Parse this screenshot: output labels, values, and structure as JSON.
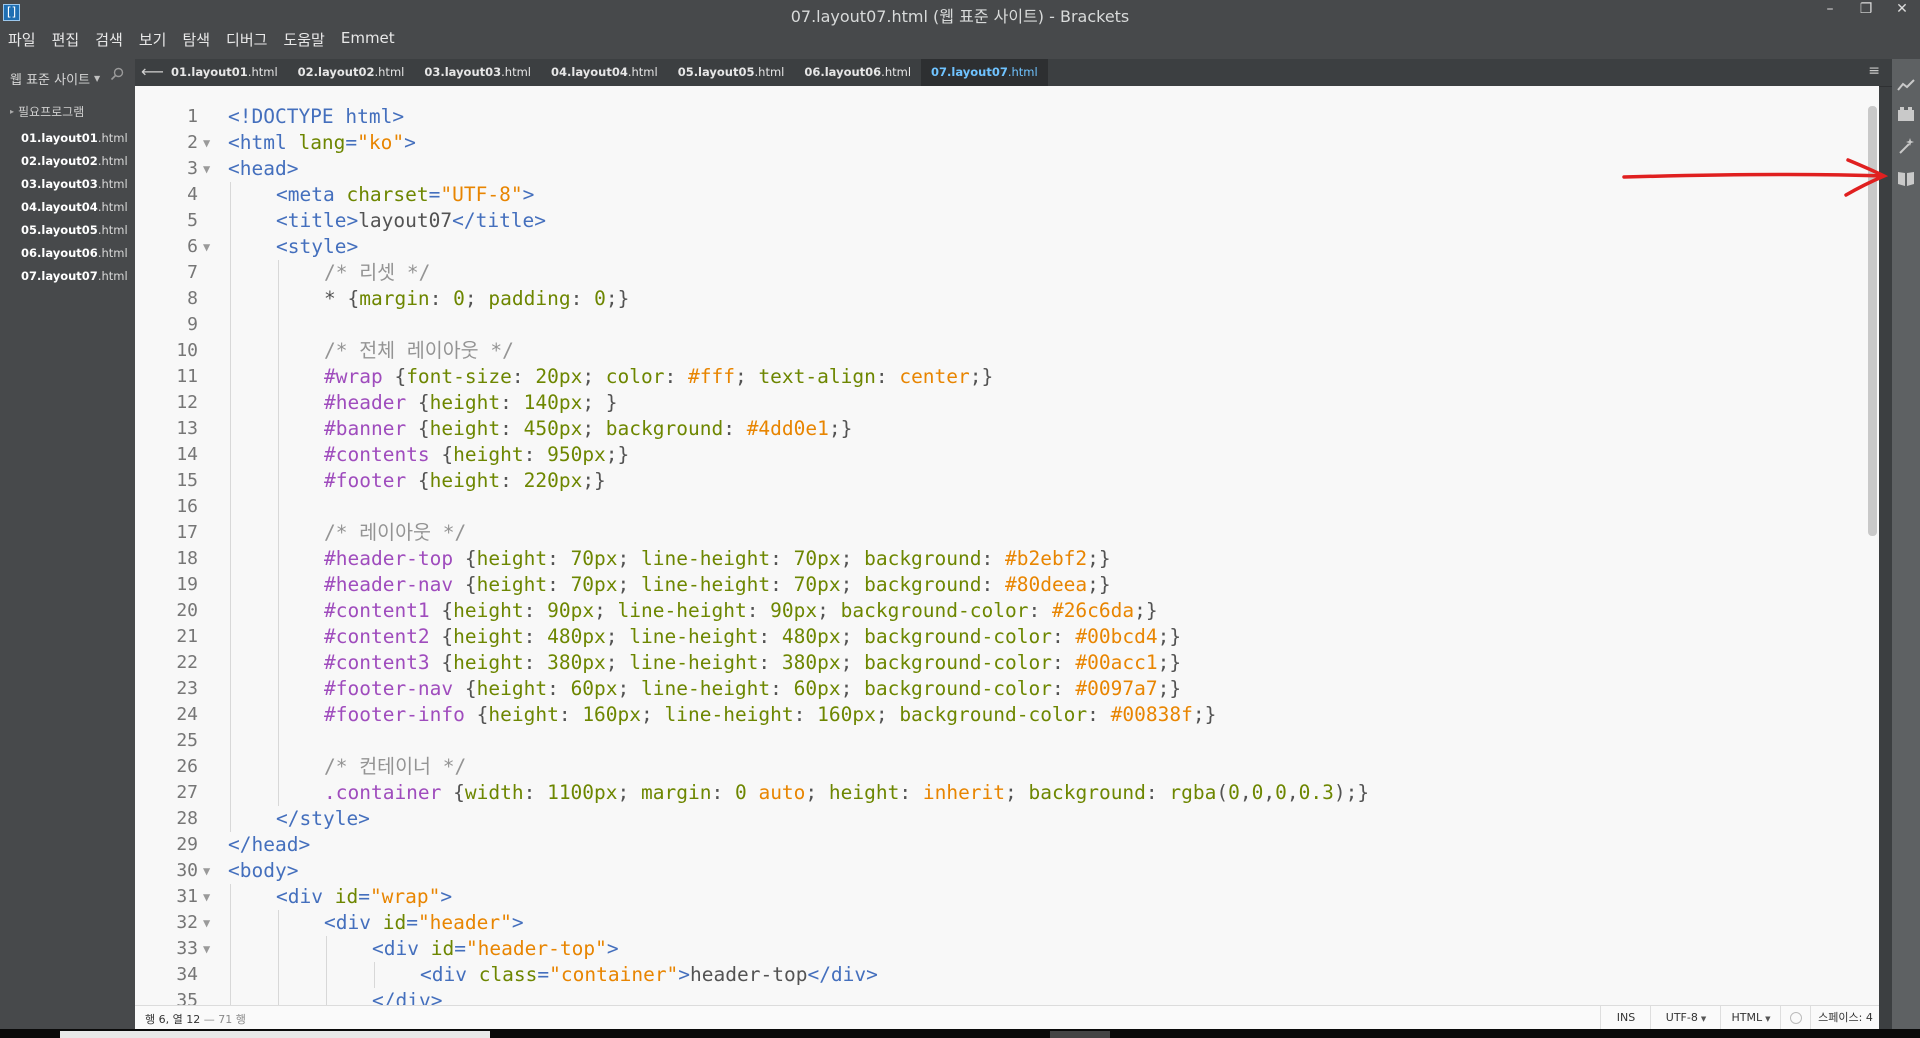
{
  "window": {
    "title": "07.layout07.html (웹 표준 사이트) - Brackets",
    "controls": [
      "–",
      "❐",
      "✕"
    ]
  },
  "menu": [
    "파일",
    "편집",
    "검색",
    "보기",
    "탐색",
    "디버그",
    "도움말",
    "Emmet"
  ],
  "sidebar": {
    "project_name": "웹 표준 사이트",
    "folder": "필요프로그램",
    "files": [
      {
        "name": "01.layout01",
        "ext": ".html"
      },
      {
        "name": "02.layout02",
        "ext": ".html"
      },
      {
        "name": "03.layout03",
        "ext": ".html"
      },
      {
        "name": "04.layout04",
        "ext": ".html"
      },
      {
        "name": "05.layout05",
        "ext": ".html"
      },
      {
        "name": "06.layout06",
        "ext": ".html"
      },
      {
        "name": "07.layout07",
        "ext": ".html"
      }
    ]
  },
  "tabs": [
    {
      "name": "01.layout01",
      "ext": ".html"
    },
    {
      "name": "02.layout02",
      "ext": ".html"
    },
    {
      "name": "03.layout03",
      "ext": ".html"
    },
    {
      "name": "04.layout04",
      "ext": ".html"
    },
    {
      "name": "05.layout05",
      "ext": ".html"
    },
    {
      "name": "06.layout06",
      "ext": ".html"
    },
    {
      "name": "07.layout07",
      "ext": ".html",
      "active": true
    }
  ],
  "editor": {
    "lines": [
      {
        "n": "1",
        "fold": false,
        "indent": 0,
        "tokens": [
          [
            "tag",
            "<!DOCTYPE html>"
          ]
        ]
      },
      {
        "n": "2",
        "fold": true,
        "indent": 0,
        "tokens": [
          [
            "tag",
            "<html "
          ],
          [
            "attr",
            "lang"
          ],
          [
            "tag",
            "="
          ],
          [
            "str",
            "\"ko\""
          ],
          [
            "tag",
            ">"
          ]
        ]
      },
      {
        "n": "3",
        "fold": true,
        "indent": 0,
        "tokens": [
          [
            "tag",
            "<head>"
          ]
        ]
      },
      {
        "n": "4",
        "fold": false,
        "indent": 1,
        "tokens": [
          [
            "tag",
            "<meta "
          ],
          [
            "attr",
            "charset"
          ],
          [
            "tag",
            "="
          ],
          [
            "str",
            "\"UTF-8\""
          ],
          [
            "tag",
            ">"
          ]
        ]
      },
      {
        "n": "5",
        "fold": false,
        "indent": 1,
        "tokens": [
          [
            "tag",
            "<title>"
          ],
          [
            "txt",
            "layout07"
          ],
          [
            "tag",
            "</title>"
          ]
        ]
      },
      {
        "n": "6",
        "fold": true,
        "indent": 1,
        "tokens": [
          [
            "tag",
            "<style>"
          ]
        ]
      },
      {
        "n": "7",
        "fold": false,
        "indent": 2,
        "tokens": [
          [
            "com",
            "/* 리셋 */"
          ]
        ]
      },
      {
        "n": "8",
        "fold": false,
        "indent": 2,
        "tokens": [
          [
            "txt",
            "* {"
          ],
          [
            "prop",
            "margin"
          ],
          [
            "txt",
            ": "
          ],
          [
            "num",
            "0"
          ],
          [
            "txt",
            "; "
          ],
          [
            "prop",
            "padding"
          ],
          [
            "txt",
            ": "
          ],
          [
            "num",
            "0"
          ],
          [
            "txt",
            ";}"
          ]
        ]
      },
      {
        "n": "9",
        "fold": false,
        "indent": 2,
        "tokens": []
      },
      {
        "n": "10",
        "fold": false,
        "indent": 2,
        "tokens": [
          [
            "com",
            "/* 전체 레이아웃 */"
          ]
        ]
      },
      {
        "n": "11",
        "fold": false,
        "indent": 2,
        "tokens": [
          [
            "sel",
            "#wrap"
          ],
          [
            "txt",
            " {"
          ],
          [
            "prop",
            "font-size"
          ],
          [
            "txt",
            ": "
          ],
          [
            "num",
            "20px"
          ],
          [
            "txt",
            "; "
          ],
          [
            "prop",
            "color"
          ],
          [
            "txt",
            ": "
          ],
          [
            "val",
            "#fff"
          ],
          [
            "txt",
            "; "
          ],
          [
            "prop",
            "text-align"
          ],
          [
            "txt",
            ": "
          ],
          [
            "val",
            "center"
          ],
          [
            "txt",
            ";}"
          ]
        ]
      },
      {
        "n": "12",
        "fold": false,
        "indent": 2,
        "tokens": [
          [
            "sel",
            "#header"
          ],
          [
            "txt",
            " {"
          ],
          [
            "prop",
            "height"
          ],
          [
            "txt",
            ": "
          ],
          [
            "num",
            "140px"
          ],
          [
            "txt",
            "; }"
          ]
        ]
      },
      {
        "n": "13",
        "fold": false,
        "indent": 2,
        "tokens": [
          [
            "sel",
            "#banner"
          ],
          [
            "txt",
            " {"
          ],
          [
            "prop",
            "height"
          ],
          [
            "txt",
            ": "
          ],
          [
            "num",
            "450px"
          ],
          [
            "txt",
            "; "
          ],
          [
            "prop",
            "background"
          ],
          [
            "txt",
            ": "
          ],
          [
            "val",
            "#4dd0e1"
          ],
          [
            "txt",
            ";}"
          ]
        ]
      },
      {
        "n": "14",
        "fold": false,
        "indent": 2,
        "tokens": [
          [
            "sel",
            "#contents"
          ],
          [
            "txt",
            " {"
          ],
          [
            "prop",
            "height"
          ],
          [
            "txt",
            ": "
          ],
          [
            "num",
            "950px"
          ],
          [
            "txt",
            ";}"
          ]
        ]
      },
      {
        "n": "15",
        "fold": false,
        "indent": 2,
        "tokens": [
          [
            "sel",
            "#footer"
          ],
          [
            "txt",
            " {"
          ],
          [
            "prop",
            "height"
          ],
          [
            "txt",
            ": "
          ],
          [
            "num",
            "220px"
          ],
          [
            "txt",
            ";}"
          ]
        ]
      },
      {
        "n": "16",
        "fold": false,
        "indent": 2,
        "tokens": []
      },
      {
        "n": "17",
        "fold": false,
        "indent": 2,
        "tokens": [
          [
            "com",
            "/* 레이아웃 */"
          ]
        ]
      },
      {
        "n": "18",
        "fold": false,
        "indent": 2,
        "tokens": [
          [
            "sel",
            "#header-top"
          ],
          [
            "txt",
            " {"
          ],
          [
            "prop",
            "height"
          ],
          [
            "txt",
            ": "
          ],
          [
            "num",
            "70px"
          ],
          [
            "txt",
            "; "
          ],
          [
            "prop",
            "line-height"
          ],
          [
            "txt",
            ": "
          ],
          [
            "num",
            "70px"
          ],
          [
            "txt",
            "; "
          ],
          [
            "prop",
            "background"
          ],
          [
            "txt",
            ": "
          ],
          [
            "val",
            "#b2ebf2"
          ],
          [
            "txt",
            ";}"
          ]
        ]
      },
      {
        "n": "19",
        "fold": false,
        "indent": 2,
        "tokens": [
          [
            "sel",
            "#header-nav"
          ],
          [
            "txt",
            " {"
          ],
          [
            "prop",
            "height"
          ],
          [
            "txt",
            ": "
          ],
          [
            "num",
            "70px"
          ],
          [
            "txt",
            "; "
          ],
          [
            "prop",
            "line-height"
          ],
          [
            "txt",
            ": "
          ],
          [
            "num",
            "70px"
          ],
          [
            "txt",
            "; "
          ],
          [
            "prop",
            "background"
          ],
          [
            "txt",
            ": "
          ],
          [
            "val",
            "#80deea"
          ],
          [
            "txt",
            ";}"
          ]
        ]
      },
      {
        "n": "20",
        "fold": false,
        "indent": 2,
        "tokens": [
          [
            "sel",
            "#content1"
          ],
          [
            "txt",
            " {"
          ],
          [
            "prop",
            "height"
          ],
          [
            "txt",
            ": "
          ],
          [
            "num",
            "90px"
          ],
          [
            "txt",
            "; "
          ],
          [
            "prop",
            "line-height"
          ],
          [
            "txt",
            ": "
          ],
          [
            "num",
            "90px"
          ],
          [
            "txt",
            "; "
          ],
          [
            "prop",
            "background-color"
          ],
          [
            "txt",
            ": "
          ],
          [
            "val",
            "#26c6da"
          ],
          [
            "txt",
            ";}"
          ]
        ]
      },
      {
        "n": "21",
        "fold": false,
        "indent": 2,
        "tokens": [
          [
            "sel",
            "#content2"
          ],
          [
            "txt",
            " {"
          ],
          [
            "prop",
            "height"
          ],
          [
            "txt",
            ": "
          ],
          [
            "num",
            "480px"
          ],
          [
            "txt",
            "; "
          ],
          [
            "prop",
            "line-height"
          ],
          [
            "txt",
            ": "
          ],
          [
            "num",
            "480px"
          ],
          [
            "txt",
            "; "
          ],
          [
            "prop",
            "background-color"
          ],
          [
            "txt",
            ": "
          ],
          [
            "val",
            "#00bcd4"
          ],
          [
            "txt",
            ";}"
          ]
        ]
      },
      {
        "n": "22",
        "fold": false,
        "indent": 2,
        "tokens": [
          [
            "sel",
            "#content3"
          ],
          [
            "txt",
            " {"
          ],
          [
            "prop",
            "height"
          ],
          [
            "txt",
            ": "
          ],
          [
            "num",
            "380px"
          ],
          [
            "txt",
            "; "
          ],
          [
            "prop",
            "line-height"
          ],
          [
            "txt",
            ": "
          ],
          [
            "num",
            "380px"
          ],
          [
            "txt",
            "; "
          ],
          [
            "prop",
            "background-color"
          ],
          [
            "txt",
            ": "
          ],
          [
            "val",
            "#00acc1"
          ],
          [
            "txt",
            ";}"
          ]
        ]
      },
      {
        "n": "23",
        "fold": false,
        "indent": 2,
        "tokens": [
          [
            "sel",
            "#footer-nav"
          ],
          [
            "txt",
            " {"
          ],
          [
            "prop",
            "height"
          ],
          [
            "txt",
            ": "
          ],
          [
            "num",
            "60px"
          ],
          [
            "txt",
            "; "
          ],
          [
            "prop",
            "line-height"
          ],
          [
            "txt",
            ": "
          ],
          [
            "num",
            "60px"
          ],
          [
            "txt",
            "; "
          ],
          [
            "prop",
            "background-color"
          ],
          [
            "txt",
            ": "
          ],
          [
            "val",
            "#0097a7"
          ],
          [
            "txt",
            ";}"
          ]
        ]
      },
      {
        "n": "24",
        "fold": false,
        "indent": 2,
        "tokens": [
          [
            "sel",
            "#footer-info"
          ],
          [
            "txt",
            " {"
          ],
          [
            "prop",
            "height"
          ],
          [
            "txt",
            ": "
          ],
          [
            "num",
            "160px"
          ],
          [
            "txt",
            "; "
          ],
          [
            "prop",
            "line-height"
          ],
          [
            "txt",
            ": "
          ],
          [
            "num",
            "160px"
          ],
          [
            "txt",
            "; "
          ],
          [
            "prop",
            "background-color"
          ],
          [
            "txt",
            ": "
          ],
          [
            "val",
            "#00838f"
          ],
          [
            "txt",
            ";}"
          ]
        ]
      },
      {
        "n": "25",
        "fold": false,
        "indent": 2,
        "tokens": []
      },
      {
        "n": "26",
        "fold": false,
        "indent": 2,
        "tokens": [
          [
            "com",
            "/* 컨테이너 */"
          ]
        ]
      },
      {
        "n": "27",
        "fold": false,
        "indent": 2,
        "tokens": [
          [
            "sel",
            ".container"
          ],
          [
            "txt",
            " {"
          ],
          [
            "prop",
            "width"
          ],
          [
            "txt",
            ": "
          ],
          [
            "num",
            "1100px"
          ],
          [
            "txt",
            "; "
          ],
          [
            "prop",
            "margin"
          ],
          [
            "txt",
            ": "
          ],
          [
            "num",
            "0"
          ],
          [
            "txt",
            " "
          ],
          [
            "val",
            "auto"
          ],
          [
            "txt",
            "; "
          ],
          [
            "prop",
            "height"
          ],
          [
            "txt",
            ": "
          ],
          [
            "val",
            "inherit"
          ],
          [
            "txt",
            "; "
          ],
          [
            "prop",
            "background"
          ],
          [
            "txt",
            ": "
          ],
          [
            "num",
            "rgba"
          ],
          [
            "txt",
            "("
          ],
          [
            "num",
            "0"
          ],
          [
            "txt",
            ","
          ],
          [
            "num",
            "0"
          ],
          [
            "txt",
            ","
          ],
          [
            "num",
            "0"
          ],
          [
            "txt",
            ","
          ],
          [
            "num",
            "0.3"
          ],
          [
            "txt",
            ");}"
          ]
        ]
      },
      {
        "n": "28",
        "fold": false,
        "indent": 1,
        "tokens": [
          [
            "tag",
            "</style>"
          ]
        ]
      },
      {
        "n": "29",
        "fold": false,
        "indent": 0,
        "tokens": [
          [
            "tag",
            "</head>"
          ]
        ]
      },
      {
        "n": "30",
        "fold": true,
        "indent": 0,
        "tokens": [
          [
            "tag",
            "<body>"
          ]
        ]
      },
      {
        "n": "31",
        "fold": true,
        "indent": 1,
        "tokens": [
          [
            "tag",
            "<div "
          ],
          [
            "attr",
            "id"
          ],
          [
            "tag",
            "="
          ],
          [
            "str",
            "\"wrap\""
          ],
          [
            "tag",
            ">"
          ]
        ]
      },
      {
        "n": "32",
        "fold": true,
        "indent": 2,
        "tokens": [
          [
            "tag",
            "<div "
          ],
          [
            "attr",
            "id"
          ],
          [
            "tag",
            "="
          ],
          [
            "str",
            "\"header\""
          ],
          [
            "tag",
            ">"
          ]
        ]
      },
      {
        "n": "33",
        "fold": true,
        "indent": 3,
        "tokens": [
          [
            "tag",
            "<div "
          ],
          [
            "attr",
            "id"
          ],
          [
            "tag",
            "="
          ],
          [
            "str",
            "\"header-top\""
          ],
          [
            "tag",
            ">"
          ]
        ]
      },
      {
        "n": "34",
        "fold": false,
        "indent": 4,
        "tokens": [
          [
            "tag",
            "<div "
          ],
          [
            "attr",
            "class"
          ],
          [
            "tag",
            "="
          ],
          [
            "str",
            "\"container\""
          ],
          [
            "tag",
            ">"
          ],
          [
            "txt",
            "header-top"
          ],
          [
            "tag",
            "</div>"
          ]
        ]
      },
      {
        "n": "35",
        "fold": false,
        "indent": 3,
        "tokens": [
          [
            "tag",
            "</div>"
          ]
        ]
      }
    ]
  },
  "statusbar": {
    "cursor": "행 6, 열 12",
    "lines": "— 71 행",
    "mode": "INS",
    "encoding": "UTF-8",
    "language": "HTML",
    "indent": "스페이스: 4"
  },
  "right_toolbar": [
    "live-preview-icon",
    "extension-manager-icon",
    "magic-wand-icon",
    "book-icon"
  ],
  "colors": {
    "accent": "#6fc3ff",
    "annotation": "#e02020"
  }
}
